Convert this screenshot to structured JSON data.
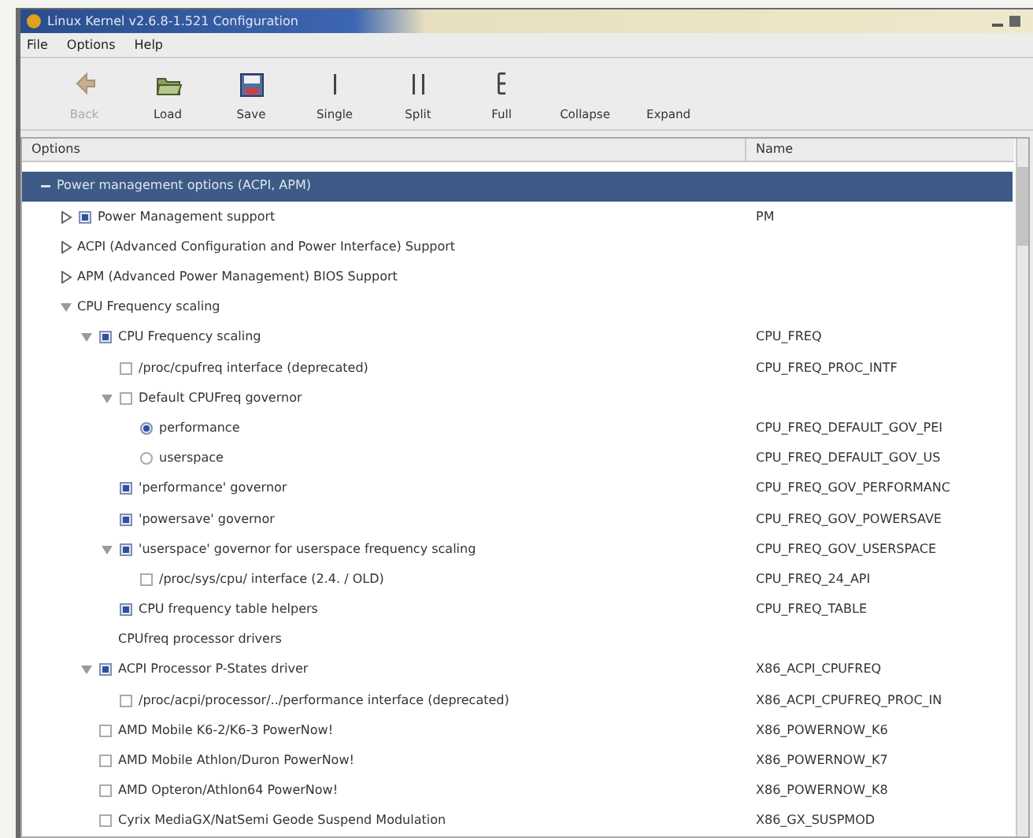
{
  "window": {
    "title": "Linux Kernel v2.6.8-1.521 Configuration"
  },
  "menu": [
    "File",
    "Options",
    "Help"
  ],
  "toolbar": [
    {
      "label": "Back",
      "kind": "back",
      "disabled": true
    },
    {
      "label": "Load",
      "kind": "load",
      "disabled": false
    },
    {
      "label": "Save",
      "kind": "save",
      "disabled": false
    },
    {
      "label": "Single",
      "kind": "single",
      "disabled": false
    },
    {
      "label": "Split",
      "kind": "split",
      "disabled": false
    },
    {
      "label": "Full",
      "kind": "full",
      "disabled": false
    },
    {
      "label": "Collapse",
      "kind": "text",
      "disabled": false
    },
    {
      "label": "Expand",
      "kind": "text",
      "disabled": false
    }
  ],
  "columns": [
    "Options",
    "Name"
  ],
  "tree": [
    {
      "label": "Power management options (ACPI, APM)",
      "kind": "menu",
      "expanded": true,
      "selected": true,
      "children": [
        {
          "label": "Power Management support",
          "kind": "checkbox",
          "checked": true,
          "expanded": false,
          "selected": false,
          "symbol": "PM"
        },
        {
          "label": "ACPI (Advanced Configuration and Power Interface) Support",
          "kind": "menu",
          "expanded": false,
          "selected": false
        },
        {
          "label": "APM (Advanced Power Management) BIOS Support",
          "kind": "menu",
          "expanded": false,
          "selected": false
        },
        {
          "label": "CPU Frequency scaling",
          "kind": "menu",
          "expanded": true,
          "selected": false,
          "children": [
            {
              "label": "CPU Frequency scaling",
              "kind": "checkbox",
              "checked": true,
              "expanded": true,
              "selected": false,
              "symbol": "CPU_FREQ",
              "children": [
                {
                  "label": "/proc/cpufreq interface (deprecated)",
                  "kind": "checkbox",
                  "checked": false,
                  "selected": false,
                  "symbol": "CPU_FREQ_PROC_INTF"
                },
                {
                  "label": "Default CPUFreq governor",
                  "kind": "checkbox",
                  "checked": false,
                  "expanded": true,
                  "selected": false,
                  "children": [
                    {
                      "label": "performance",
                      "kind": "radio",
                      "checked": true,
                      "selected": false,
                      "symbol": "CPU_FREQ_DEFAULT_GOV_PEI"
                    },
                    {
                      "label": "userspace",
                      "kind": "radio",
                      "checked": false,
                      "selected": false,
                      "symbol": "CPU_FREQ_DEFAULT_GOV_US"
                    }
                  ]
                },
                {
                  "label": "'performance' governor",
                  "kind": "checkbox",
                  "checked": true,
                  "selected": false,
                  "symbol": "CPU_FREQ_GOV_PERFORMANC"
                },
                {
                  "label": "'powersave' governor",
                  "kind": "checkbox",
                  "checked": true,
                  "selected": false,
                  "symbol": "CPU_FREQ_GOV_POWERSAVE"
                },
                {
                  "label": "'userspace' governor for userspace frequency scaling",
                  "kind": "checkbox",
                  "checked": true,
                  "expanded": true,
                  "selected": false,
                  "symbol": "CPU_FREQ_GOV_USERSPACE",
                  "children": [
                    {
                      "label": "/proc/sys/cpu/ interface (2.4. / OLD)",
                      "kind": "checkbox",
                      "checked": false,
                      "selected": false,
                      "symbol": "CPU_FREQ_24_API"
                    }
                  ]
                },
                {
                  "label": "CPU frequency table helpers",
                  "kind": "checkbox",
                  "checked": true,
                  "selected": false,
                  "symbol": "CPU_FREQ_TABLE"
                }
              ]
            },
            {
              "label": "CPUfreq processor drivers",
              "kind": "comment",
              "selected": false
            },
            {
              "label": "ACPI Processor P-States driver",
              "kind": "checkbox",
              "checked": true,
              "expanded": true,
              "selected": false,
              "symbol": "X86_ACPI_CPUFREQ",
              "children": [
                {
                  "label": "/proc/acpi/processor/../performance interface (deprecated)",
                  "kind": "checkbox",
                  "checked": false,
                  "selected": false,
                  "symbol": "X86_ACPI_CPUFREQ_PROC_IN"
                }
              ]
            },
            {
              "label": "AMD Mobile K6-2/K6-3 PowerNow!",
              "kind": "checkbox",
              "checked": false,
              "selected": false,
              "symbol": "X86_POWERNOW_K6"
            },
            {
              "label": "AMD Mobile Athlon/Duron PowerNow!",
              "kind": "checkbox",
              "checked": false,
              "selected": false,
              "symbol": "X86_POWERNOW_K7"
            },
            {
              "label": "AMD Opteron/Athlon64 PowerNow!",
              "kind": "checkbox",
              "checked": false,
              "selected": false,
              "symbol": "X86_POWERNOW_K8"
            },
            {
              "label": "Cyrix MediaGX/NatSemi Geode Suspend Modulation",
              "kind": "checkbox",
              "checked": false,
              "selected": false,
              "symbol": "X86_GX_SUSPMOD"
            }
          ]
        }
      ]
    }
  ]
}
